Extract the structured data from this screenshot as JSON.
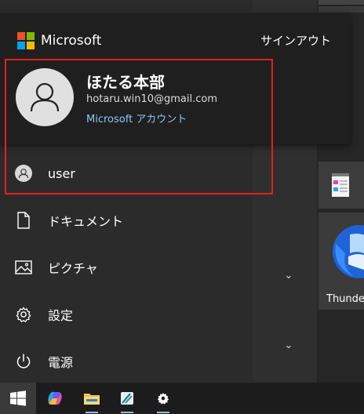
{
  "account": {
    "brand_name": "Microsoft",
    "sign_out_label": "サインアウト",
    "display_name": "ほたる本部",
    "email": "hotaru.win10@gmail.com",
    "account_link_label": "Microsoft アカウント"
  },
  "menu": {
    "items": [
      {
        "label": "user",
        "icon": "user-avatar-icon"
      },
      {
        "label": "ドキュメント",
        "icon": "document-icon"
      },
      {
        "label": "ピクチャ",
        "icon": "picture-icon"
      },
      {
        "label": "設定",
        "icon": "gear-icon"
      },
      {
        "label": "電源",
        "icon": "power-icon"
      }
    ]
  },
  "tiles": {
    "thunderbird_label": "Thunde"
  },
  "taskbar": {
    "icons": [
      "windows-start-icon",
      "copilot-icon",
      "file-explorer-icon",
      "snipping-tool-icon",
      "settings-gear-icon"
    ]
  },
  "colors": {
    "ms_red": "#f25022",
    "ms_green": "#7fba00",
    "ms_blue": "#00a4ef",
    "ms_yellow": "#ffb900",
    "link": "#8fc4f5",
    "highlight": "#e32020"
  }
}
